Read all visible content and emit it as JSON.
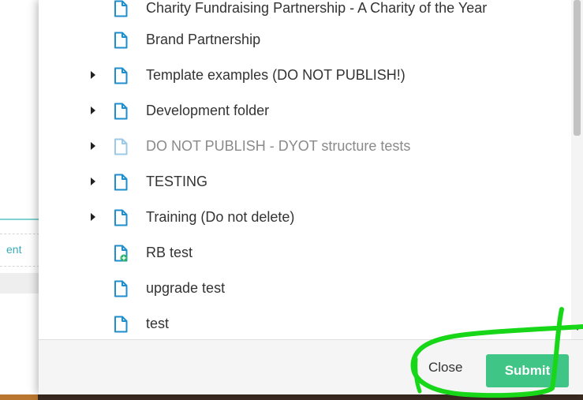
{
  "background": {
    "tab_label": "ent"
  },
  "tree": {
    "items": [
      {
        "label": "Charity Fundraising Partnership -  A Charity of the Year",
        "has_children": false,
        "icon": "document-icon",
        "muted": false
      },
      {
        "label": "Brand Partnership",
        "has_children": false,
        "icon": "document-icon",
        "muted": false
      },
      {
        "label": "Template examples (DO NOT PUBLISH!)",
        "has_children": true,
        "icon": "document-icon",
        "muted": false
      },
      {
        "label": "Development folder",
        "has_children": true,
        "icon": "document-icon",
        "muted": false
      },
      {
        "label": "DO NOT PUBLISH - DYOT structure tests",
        "has_children": true,
        "icon": "document-icon",
        "muted": true
      },
      {
        "label": "TESTING",
        "has_children": true,
        "icon": "document-icon",
        "muted": false
      },
      {
        "label": "Training (Do not delete)",
        "has_children": true,
        "icon": "document-icon",
        "muted": false
      },
      {
        "label": "RB test",
        "has_children": false,
        "icon": "document-add-icon",
        "muted": false
      },
      {
        "label": "upgrade test",
        "has_children": false,
        "icon": "document-icon",
        "muted": false
      },
      {
        "label": "test",
        "has_children": false,
        "icon": "document-icon",
        "muted": false
      }
    ]
  },
  "footer": {
    "close_label": "Close",
    "submit_label": "Submit"
  },
  "colors": {
    "icon_blue": "#1f8ecd",
    "icon_blue_muted": "#9cc9e6",
    "submit_green": "#3fc586",
    "annotation_green": "#18d718"
  }
}
